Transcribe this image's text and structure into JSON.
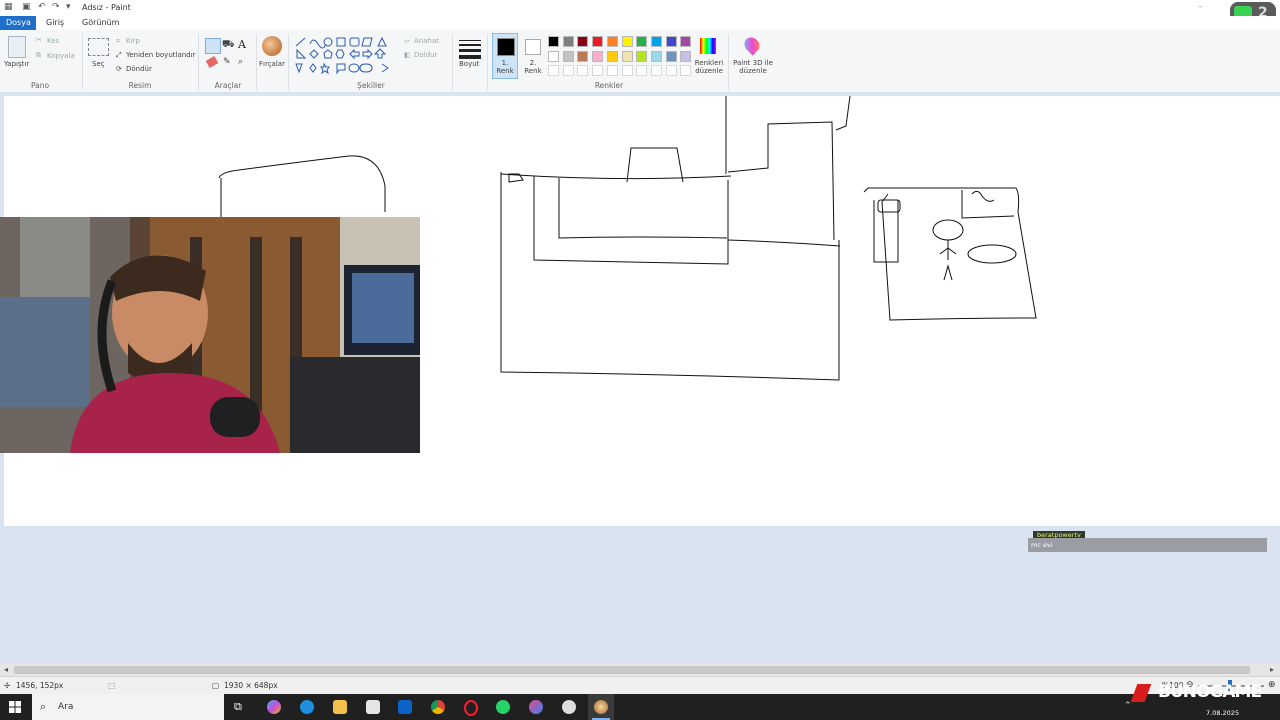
{
  "window": {
    "title": "Adsız - Paint"
  },
  "menu": {
    "tabs": [
      "Dosya",
      "Giriş",
      "Görünüm"
    ]
  },
  "ribbon": {
    "pano": {
      "paste": "Yapıştır",
      "cut": "Kes",
      "copy": "Kopyala",
      "label": "Pano"
    },
    "resim": {
      "select": "Seç",
      "crop": "Kırp",
      "resize": "Yeniden boyutlandır",
      "rotate": "Döndür",
      "label": "Resim"
    },
    "araclar": {
      "label": "Araçlar"
    },
    "fircalar": {
      "label": "Fırçalar"
    },
    "sekiller": {
      "outline": "Anahat",
      "fill": "Doldur",
      "label": "Şekiller"
    },
    "boyut": {
      "label": "Boyut"
    },
    "renkler": {
      "color1": "1. Renk",
      "color2": "2. Renk",
      "edit": "Renkleri düzenle",
      "label": "Renkler",
      "row1": [
        "#000000",
        "#7f7f7f",
        "#880015",
        "#ed1c24",
        "#ff7f27",
        "#fff200",
        "#22b14c",
        "#00a2e8",
        "#3f48cc",
        "#a349a4"
      ],
      "row2": [
        "#ffffff",
        "#c3c3c3",
        "#b97a57",
        "#ffaec9",
        "#ffc90e",
        "#efe4b0",
        "#b5e61d",
        "#99d9ea",
        "#7092be",
        "#c8bfe7"
      ]
    },
    "paint3d": "Paint 3D ile düzenle"
  },
  "chat": {
    "user": "beratpowertv",
    "message": "mc evi"
  },
  "status": {
    "cursor": "1456, 152px",
    "size": "1930 × 648px",
    "zoom": "%100"
  },
  "taskbar": {
    "search": "Ara",
    "date": "7.08.2025"
  },
  "overlay": {
    "brand": "BUNOGAME"
  }
}
